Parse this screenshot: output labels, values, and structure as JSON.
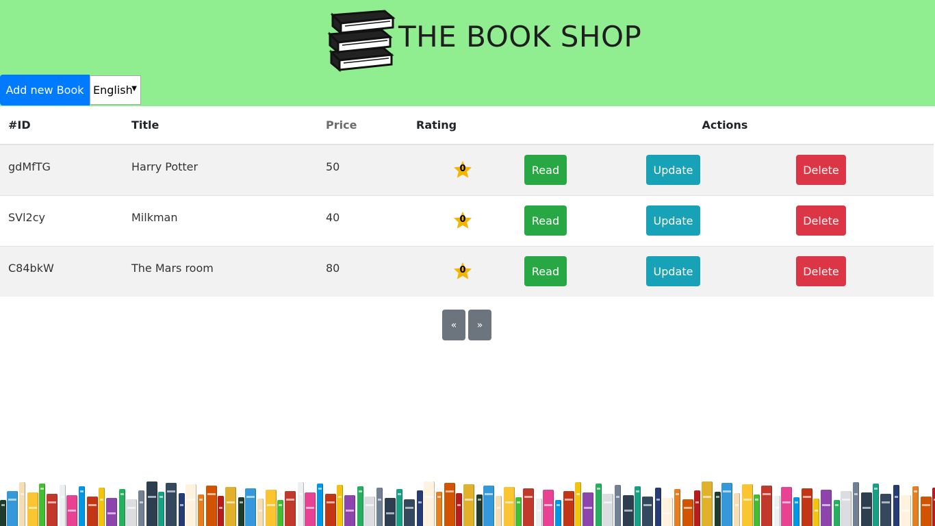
{
  "header": {
    "title": "THE BOOK SHOP",
    "logo_icon": "stacked-books-icon",
    "background": "#90ee90"
  },
  "toolbar": {
    "add_label": "Add new Book",
    "language_selected": "English"
  },
  "table": {
    "columns": {
      "id": "#ID",
      "title": "Title",
      "price": "Price",
      "rating": "Rating",
      "actions": "Actions"
    },
    "rows": [
      {
        "id": "gdMfTG",
        "title": "Harry Potter",
        "price": "50",
        "rating": "0"
      },
      {
        "id": "SVl2cy",
        "title": "Milkman",
        "price": "40",
        "rating": "0"
      },
      {
        "id": "C84bkW",
        "title": "The Mars room",
        "price": "80",
        "rating": "0"
      }
    ],
    "actions": {
      "read": "Read",
      "update": "Update",
      "delete": "Delete"
    }
  },
  "pagination": {
    "prev": "«",
    "next": "»"
  },
  "colors": {
    "primary": "#007bff",
    "read": "#28a745",
    "update": "#17a2b8",
    "delete": "#dc3545",
    "pager": "#6c757d",
    "star": "#f4b400"
  },
  "decorations": {
    "footer_image": "bookshelf-spines-illustration"
  }
}
